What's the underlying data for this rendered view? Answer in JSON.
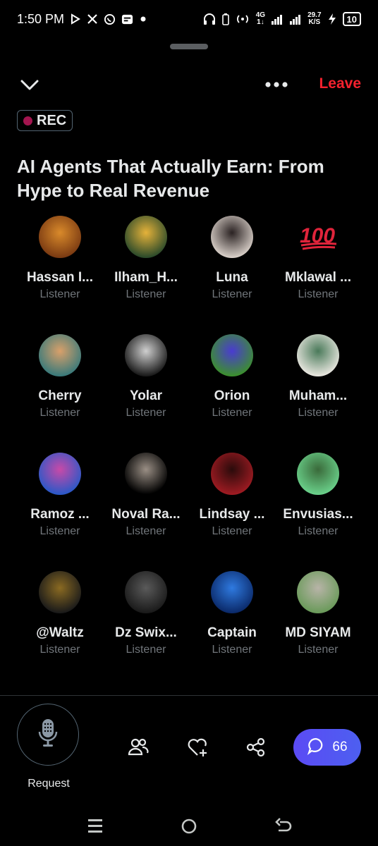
{
  "status_bar": {
    "time": "1:50 PM",
    "network": "4G",
    "network_sub": "1↓",
    "speed": "29.7",
    "speed_unit": "K/S",
    "battery": "10"
  },
  "header": {
    "leave_label": "Leave",
    "rec_label": "REC"
  },
  "space": {
    "title": "AI Agents That Actually Earn: From Hype to Real Revenue"
  },
  "participants": [
    {
      "name": "Hassan I...",
      "role": "Listener",
      "color1": "#7a3a12",
      "color2": "#d98a2b"
    },
    {
      "name": "Ilham_H...",
      "role": "Listener",
      "color1": "#2b4a2a",
      "color2": "#e5b23a"
    },
    {
      "name": "Luna",
      "role": "Listener",
      "color1": "#d8cfc8",
      "color2": "#2a2222"
    },
    {
      "name": "Mklawal ...",
      "role": "Listener",
      "emoji": "100"
    },
    {
      "name": "Cherry",
      "role": "Listener",
      "color1": "#3a7a7a",
      "color2": "#d9a06a"
    },
    {
      "name": "Yolar",
      "role": "Listener",
      "color1": "#1a1a1a",
      "color2": "#cfcfcf"
    },
    {
      "name": "Orion",
      "role": "Listener",
      "color1": "#3c8f2e",
      "color2": "#4a3bd1"
    },
    {
      "name": "Muham...",
      "role": "Listener",
      "color1": "#e8e6df",
      "color2": "#4a7a5a"
    },
    {
      "name": "Ramoz ...",
      "role": "Listener",
      "color1": "#2b58c7",
      "color2": "#c84aa8"
    },
    {
      "name": "Noval Ra...",
      "role": "Listener",
      "color1": "#000000",
      "color2": "#9a8f85"
    },
    {
      "name": "Lindsay ...",
      "role": "Listener",
      "color1": "#9e1b22",
      "color2": "#2a0b0b"
    },
    {
      "name": "Envusias...",
      "role": "Listener",
      "color1": "#6ad08a",
      "color2": "#3a6a3a"
    },
    {
      "name": "@Waltz",
      "role": "Listener",
      "color1": "#1a1a1a",
      "color2": "#8a6a22"
    },
    {
      "name": "Dz Swix...",
      "role": "Listener",
      "color1": "#1a1a1a",
      "color2": "#5a5a5a"
    },
    {
      "name": "Captain",
      "role": "Listener",
      "color1": "#0b2a6a",
      "color2": "#2f7ae0"
    },
    {
      "name": "MD SIYAM",
      "role": "Listener",
      "color1": "#6a9a5a",
      "color2": "#b8b4a8"
    }
  ],
  "footer": {
    "request_label": "Request",
    "chat_count": "66"
  },
  "colors": {
    "leave": "#f4212e",
    "rec_dot": "#a3154f",
    "chat_button": "#5b4bf5",
    "secondary_text": "#71767b"
  }
}
